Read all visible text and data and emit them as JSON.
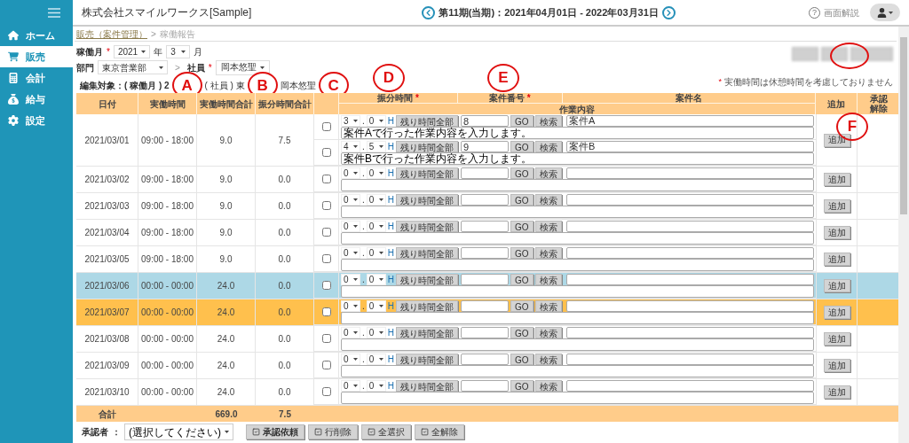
{
  "sidebar": {
    "items": [
      {
        "label": "ホーム",
        "selected": false
      },
      {
        "label": "販売",
        "selected": true
      },
      {
        "label": "会計",
        "selected": false
      },
      {
        "label": "給与",
        "selected": false
      },
      {
        "label": "設定",
        "selected": false
      }
    ]
  },
  "header": {
    "company": "株式会社スマイルワークス[Sample]",
    "period": "第11期(当期)：2021年04月01日 - 2022年03月31日",
    "help_icon": "?",
    "help": "画面解説"
  },
  "breadcrumb": {
    "link": "販売（案件管理）",
    "separator": ">",
    "current": "稼働報告"
  },
  "toolbar_buttons": [
    {
      "blurred": true
    },
    {
      "blurred": true
    },
    {
      "blurred": true
    }
  ],
  "filters": {
    "month_label": "稼働月",
    "month_mark": "*",
    "year": "2021",
    "year_unit": "年",
    "month": "3",
    "month_unit": "月",
    "dept_label": "部門",
    "dept": "東京営業部",
    "arrow": ">",
    "employee_label": "社員",
    "employee_mark": "*",
    "employee": "岡本悠聖"
  },
  "edit_target": [
    "編集対象：( 稼働月 ) 2",
    "( 社員 ) 東",
    "岡本悠聖"
  ],
  "note": {
    "mark": "*",
    "text": "実働時間は休憩時間を考慮しておりません"
  },
  "columns": {
    "date": "日付",
    "hours": "実働時間",
    "hours_total": "実働時間合計",
    "alloc_total": "振分時間合計",
    "alloc": "振分時間",
    "case_no": "案件番号",
    "case_name": "案件名",
    "work": "作業内容",
    "add": "追加",
    "approve": [
      "承認",
      "解除"
    ],
    "mark": "*"
  },
  "rows": [
    {
      "date": "2021/03/01",
      "hours": "09:00 - 18:00",
      "total": "9.0",
      "alloc": "7.5",
      "kind": "weekday",
      "add": "追加",
      "entries": [
        {
          "checked": false,
          "whole": "3",
          "dot": ".",
          "frac": "0",
          "unit": "H",
          "fill": "残り時間全部",
          "case_no": "8",
          "go": "GO",
          "search": "検索",
          "case_name": "案件A",
          "work": "案件Aで行った作業内容を入力します。"
        },
        {
          "checked": false,
          "whole": "4",
          "dot": ".",
          "frac": "5",
          "unit": "H",
          "fill": "残り時間全部",
          "case_no": "9",
          "go": "GO",
          "search": "検索",
          "case_name": "案件B",
          "work": "案件Bで行った作業内容を入力します。"
        }
      ]
    },
    {
      "date": "2021/03/02",
      "hours": "09:00 - 18:00",
      "total": "9.0",
      "alloc": "0.0",
      "kind": "weekday",
      "add": "追加",
      "entries": [
        {
          "checked": false,
          "whole": "0",
          "dot": ".",
          "frac": "0",
          "unit": "H",
          "fill": "残り時間全部",
          "go": "GO",
          "search": "検索"
        }
      ]
    },
    {
      "date": "2021/03/03",
      "hours": "09:00 - 18:00",
      "total": "9.0",
      "alloc": "0.0",
      "kind": "weekday",
      "add": "追加",
      "entries": [
        {
          "checked": false,
          "whole": "0",
          "dot": ".",
          "frac": "0",
          "unit": "H",
          "fill": "残り時間全部",
          "go": "GO",
          "search": "検索"
        }
      ]
    },
    {
      "date": "2021/03/04",
      "hours": "09:00 - 18:00",
      "total": "9.0",
      "alloc": "0.0",
      "kind": "weekday",
      "add": "追加",
      "entries": [
        {
          "checked": false,
          "whole": "0",
          "dot": ".",
          "frac": "0",
          "unit": "H",
          "fill": "残り時間全部",
          "go": "GO",
          "search": "検索"
        }
      ]
    },
    {
      "date": "2021/03/05",
      "hours": "09:00 - 18:00",
      "total": "9.0",
      "alloc": "0.0",
      "kind": "weekday",
      "add": "追加",
      "entries": [
        {
          "checked": false,
          "whole": "0",
          "dot": ".",
          "frac": "0",
          "unit": "H",
          "fill": "残り時間全部",
          "go": "GO",
          "search": "検索"
        }
      ]
    },
    {
      "date": "2021/03/06",
      "hours": "00:00 - 00:00",
      "total": "24.0",
      "alloc": "0.0",
      "kind": "saturday",
      "add": "追加",
      "entries": [
        {
          "checked": false,
          "whole": "0",
          "dot": ".",
          "frac": "0",
          "unit": "H",
          "fill": "残り時間全部",
          "go": "GO",
          "search": "検索"
        }
      ]
    },
    {
      "date": "2021/03/07",
      "hours": "00:00 - 00:00",
      "total": "24.0",
      "alloc": "0.0",
      "kind": "sunday",
      "add": "追加",
      "entries": [
        {
          "checked": false,
          "whole": "0",
          "dot": ".",
          "frac": "0",
          "unit": "H",
          "fill": "残り時間全部",
          "go": "GO",
          "search": "検索"
        }
      ]
    },
    {
      "date": "2021/03/08",
      "hours": "00:00 - 00:00",
      "total": "24.0",
      "alloc": "0.0",
      "kind": "weekday",
      "add": "追加",
      "entries": [
        {
          "checked": false,
          "whole": "0",
          "dot": ".",
          "frac": "0",
          "unit": "H",
          "fill": "残り時間全部",
          "go": "GO",
          "search": "検索"
        }
      ]
    },
    {
      "date": "2021/03/09",
      "hours": "00:00 - 00:00",
      "total": "24.0",
      "alloc": "0.0",
      "kind": "weekday",
      "add": "追加",
      "entries": [
        {
          "checked": false,
          "whole": "0",
          "dot": ".",
          "frac": "0",
          "unit": "H",
          "fill": "残り時間全部",
          "go": "GO",
          "search": "検索"
        }
      ]
    },
    {
      "date": "2021/03/10",
      "hours": "00:00 - 00:00",
      "total": "24.0",
      "alloc": "0.0",
      "kind": "weekday",
      "add": "追加",
      "entries": [
        {
          "checked": false,
          "whole": "0",
          "dot": ".",
          "frac": "0",
          "unit": "H",
          "fill": "残り時間全部",
          "go": "GO",
          "search": "検索"
        }
      ]
    }
  ],
  "totals": {
    "label": "合計",
    "hours_total": "669.0",
    "alloc_total": "7.5"
  },
  "footer": {
    "approver_label": "承認者",
    "colon": "：",
    "approver": "(選択してください)",
    "buttons": [
      "承認依頼",
      "行削除",
      "全選択",
      "全解除"
    ]
  },
  "annotations": [
    {
      "kind": "letter",
      "label": "A"
    },
    {
      "kind": "letter",
      "label": "B"
    },
    {
      "kind": "letter",
      "label": "C"
    },
    {
      "kind": "letter",
      "label": "D"
    },
    {
      "kind": "letter",
      "label": "E"
    },
    {
      "kind": "letter",
      "label": "F"
    },
    {
      "kind": "ring"
    }
  ]
}
